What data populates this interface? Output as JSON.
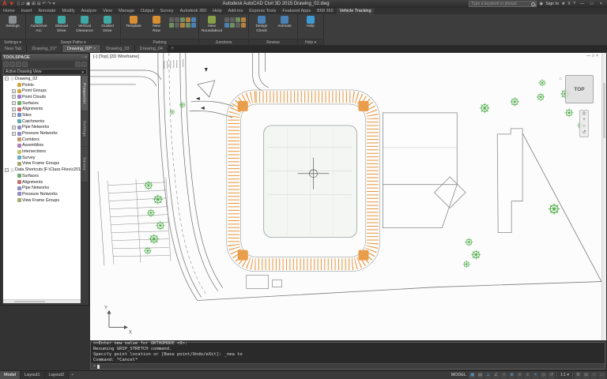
{
  "colors": {
    "accent_blue": "#5aa6dc",
    "stall_orange": "#e8963c",
    "tree_green": "#33a02c"
  },
  "titlebar": {
    "app_label": "A",
    "title": "Autodesk AutoCAD Civil 3D 2015   Drawing_02.dwg",
    "search_placeholder": "Type a keyword or phrase",
    "signin_label": "Sign In",
    "qat": [
      {
        "name": "new-file-icon",
        "glyph": "▯"
      },
      {
        "name": "open-file-icon",
        "glyph": "▱"
      },
      {
        "name": "save-icon",
        "glyph": "▣"
      },
      {
        "name": "save-as-icon",
        "glyph": "⊞"
      },
      {
        "name": "plot-icon",
        "glyph": "⊟"
      },
      {
        "name": "undo-icon",
        "glyph": "↶"
      },
      {
        "name": "redo-icon",
        "glyph": "↷"
      },
      {
        "name": "qat-dropdown-icon",
        "glyph": "▾"
      }
    ],
    "infocenter": [
      {
        "name": "favorites-star-icon",
        "glyph": "★"
      },
      {
        "name": "exchange-apps-icon",
        "glyph": "X"
      },
      {
        "name": "help-icon",
        "glyph": "?"
      }
    ],
    "window_buttons": [
      {
        "name": "minimize-button",
        "glyph": "—"
      },
      {
        "name": "restore-button",
        "glyph": "□"
      },
      {
        "name": "close-button",
        "glyph": "×"
      }
    ]
  },
  "ribbon_tabs": [
    {
      "label": "Home"
    },
    {
      "label": "Insert"
    },
    {
      "label": "Annotate"
    },
    {
      "label": "Modify"
    },
    {
      "label": "Analyze"
    },
    {
      "label": "View"
    },
    {
      "label": "Manage"
    },
    {
      "label": "Output"
    },
    {
      "label": "Survey"
    },
    {
      "label": "Autodesk 360"
    },
    {
      "label": "Help"
    },
    {
      "label": "Add-ins"
    },
    {
      "label": "Express Tools"
    },
    {
      "label": "Featured Apps"
    },
    {
      "label": "BIM 360"
    },
    {
      "label": "Vehicle Tracking",
      "active": true
    }
  ],
  "ribbon_panels": [
    {
      "label": "Settings ▾",
      "buttons": [
        {
          "label": "Settings",
          "color": "#8a8f94"
        }
      ]
    },
    {
      "label": "Swept Paths ▾",
      "buttons": [
        {
          "label": "AutoDrive\nArc",
          "color": "#3fa9a5"
        },
        {
          "label": "Manual\nDrive",
          "color": "#3fa9a5"
        },
        {
          "label": "Vertical\nClearance",
          "color": "#3fa9a5"
        },
        {
          "label": "Guided\nDrive",
          "color": "#3fa9a5"
        }
      ]
    },
    {
      "label": "Parking",
      "buttons": [
        {
          "label": "Template",
          "color": "#d98e32"
        },
        {
          "label": "New\nRow",
          "color": "#d98e32"
        }
      ]
    },
    {
      "label": "Junctions",
      "buttons": [
        {
          "label": "New\nRoundabout",
          "color": "#86a04a"
        }
      ]
    },
    {
      "label": "Review",
      "buttons": [
        {
          "label": "Design\nCheck",
          "color": "#4a82b5"
        },
        {
          "label": "Animate",
          "color": "#4a82b5"
        }
      ]
    },
    {
      "label": "Help ▾",
      "buttons": [
        {
          "label": "Help",
          "color": "#3d9bd4"
        }
      ]
    }
  ],
  "file_tabs": [
    {
      "label": "New Tab"
    },
    {
      "label": "Drawing_01*"
    },
    {
      "label": "Drawing_02*",
      "active": true
    },
    {
      "label": "Drawing_03"
    },
    {
      "label": "Drawing_04"
    }
  ],
  "toolspace": {
    "title": "TOOLSPACE",
    "combo_value": "Active Drawing View",
    "side_tabs": [
      {
        "label": "Prospector",
        "active": true
      },
      {
        "label": "Settings"
      },
      {
        "label": "Survey"
      }
    ],
    "tree": [
      {
        "label": "Drawing_02",
        "level": 0,
        "exp": "−",
        "color": "#e3e3e3"
      },
      {
        "label": "Points",
        "level": 1,
        "exp": "",
        "color": "#d4a73f"
      },
      {
        "label": "Point Groups",
        "level": 1,
        "exp": "+",
        "color": "#d4a73f"
      },
      {
        "label": "Point Clouds",
        "level": 1,
        "exp": "+",
        "color": "#9a7fc4"
      },
      {
        "label": "Surfaces",
        "level": 1,
        "exp": "+",
        "color": "#6fae6f"
      },
      {
        "label": "Alignments",
        "level": 1,
        "exp": "+",
        "color": "#c46f6f"
      },
      {
        "label": "Sites",
        "level": 1,
        "exp": "+",
        "color": "#6f8fc4"
      },
      {
        "label": "Catchments",
        "level": 1,
        "exp": "",
        "color": "#5fa9a9"
      },
      {
        "label": "Pipe Networks",
        "level": 1,
        "exp": "+",
        "color": "#8f8fc4"
      },
      {
        "label": "Pressure Networks",
        "level": 1,
        "exp": "+",
        "color": "#8f8fc4"
      },
      {
        "label": "Corridors",
        "level": 1,
        "exp": "",
        "color": "#c49a6f"
      },
      {
        "label": "Assemblies",
        "level": 1,
        "exp": "",
        "color": "#b07fb0"
      },
      {
        "label": "Intersections",
        "level": 1,
        "exp": "",
        "color": "#c4c46f"
      },
      {
        "label": "Survey",
        "level": 1,
        "exp": "",
        "color": "#6fa9c4"
      },
      {
        "label": "View Frame Groups",
        "level": 1,
        "exp": "",
        "color": "#a9a96f"
      },
      {
        "label": "Data Shortcuts [F:\\Class Files\\c2015\\Test]",
        "level": 0,
        "exp": "−",
        "color": "#e3e3e3"
      },
      {
        "label": "Surfaces",
        "level": 1,
        "exp": "",
        "color": "#6fae6f"
      },
      {
        "label": "Alignments",
        "level": 1,
        "exp": "",
        "color": "#c46f6f"
      },
      {
        "label": "Pipe Networks",
        "level": 1,
        "exp": "",
        "color": "#8f8fc4"
      },
      {
        "label": "Pressure Networks",
        "level": 1,
        "exp": "",
        "color": "#8f8fc4"
      },
      {
        "label": "View Frame Groups",
        "level": 1,
        "exp": "",
        "color": "#a9a96f"
      }
    ]
  },
  "canvas": {
    "viewport_controls": [
      {
        "label": "[-]"
      },
      {
        "label": "[Top]"
      },
      {
        "label": "[2D Wireframe]"
      }
    ],
    "window_buttons": [
      {
        "name": "viewport-minimize-button",
        "glyph": "—"
      },
      {
        "name": "viewport-restore-button",
        "glyph": "□"
      },
      {
        "name": "viewport-close-button",
        "glyph": "×"
      }
    ],
    "viewcube_label": "TOP",
    "navbar": [
      {
        "name": "navigation-wheel-icon",
        "glyph": "◎"
      },
      {
        "name": "pan-icon",
        "glyph": "+"
      },
      {
        "name": "zoom-icon",
        "glyph": "○"
      },
      {
        "name": "orbit-icon",
        "glyph": "↺"
      }
    ],
    "ucs_x": "X",
    "ucs_y": "Y"
  },
  "command": {
    "lines": [
      {
        "text": ">>Enter new value for ORTHOMODE <0>:"
      },
      {
        "text": "Resuming GRIP_STRETCH command."
      },
      {
        "text": "Specify point location or [Base point/Undo/eXit]: _nea to"
      },
      {
        "text": "Command: *Cancel*"
      }
    ],
    "prompt": ">"
  },
  "status": {
    "layout_tabs": [
      {
        "label": "Model",
        "active": true
      },
      {
        "label": "Layout1"
      },
      {
        "label": "Layout2"
      }
    ],
    "add_layout_label": "+",
    "model_label": "MODEL",
    "annotation_scale": "1:1 ▾",
    "icons": [
      {
        "name": "grid-icon",
        "glyph": "▦",
        "on": true
      },
      {
        "name": "snap-icon",
        "glyph": "▤",
        "on": false
      },
      {
        "name": "ortho-icon",
        "glyph": "⊥",
        "on": true
      },
      {
        "name": "polar-tracking-icon",
        "glyph": "∠",
        "on": false
      },
      {
        "name": "isodraft-icon",
        "glyph": "◇",
        "on": false
      },
      {
        "name": "osnap-icon",
        "glyph": "⊕",
        "on": true
      },
      {
        "name": "otrack-icon",
        "glyph": "⊙",
        "on": false
      },
      {
        "name": "lineweight-icon",
        "glyph": "≡",
        "on": false
      },
      {
        "name": "dynamic-input-icon",
        "glyph": "+",
        "on": true
      },
      {
        "name": "annotation-visibility-icon",
        "glyph": "◎",
        "on": false
      },
      {
        "name": "autoscale-icon",
        "glyph": "↺",
        "on": false
      }
    ],
    "right_icons": [
      {
        "name": "workspace-gear-icon",
        "glyph": "⚙"
      },
      {
        "name": "annotation-monitor-icon",
        "glyph": "⊟"
      },
      {
        "name": "isolate-objects-icon",
        "glyph": "○"
      },
      {
        "name": "clean-screen-icon",
        "glyph": "□"
      }
    ]
  }
}
